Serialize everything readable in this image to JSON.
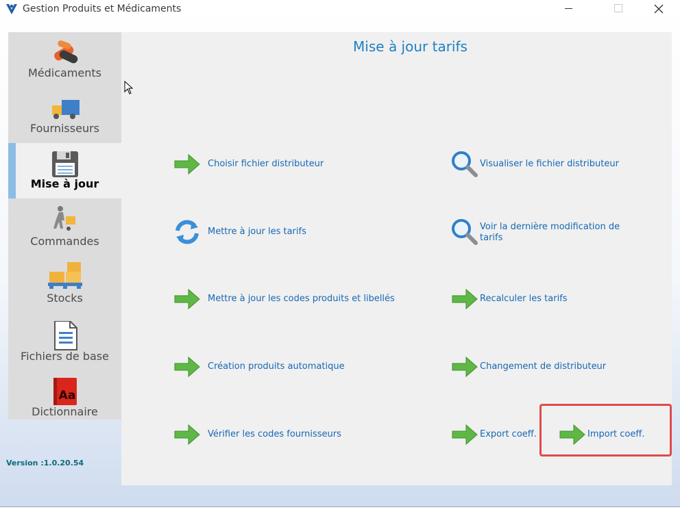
{
  "window": {
    "title": "Gestion Produits et Médicaments"
  },
  "sidebar": {
    "items": [
      {
        "label": "Médicaments",
        "icon": "medicaments-icon",
        "active": false
      },
      {
        "label": "Fournisseurs",
        "icon": "truck-icon",
        "active": false
      },
      {
        "label": "Mise à jour",
        "icon": "floppy-disk-icon",
        "active": true
      },
      {
        "label": "Commandes",
        "icon": "delivery-person-icon",
        "active": false
      },
      {
        "label": "Stocks",
        "icon": "pallet-boxes-icon",
        "active": false
      },
      {
        "label": "Fichiers de base",
        "icon": "document-icon",
        "active": false
      },
      {
        "label": "Dictionnaire",
        "icon": "dictionary-book-icon",
        "active": false
      }
    ],
    "version": "Version :1.0.20.54"
  },
  "main": {
    "title": "Mise à jour tarifs",
    "actions": [
      {
        "label": "Choisir fichier distributeur",
        "icon": "green-arrow-icon"
      },
      {
        "label": "Visualiser le fichier distributeur",
        "icon": "magnifier-icon"
      },
      {
        "label": "Mettre à jour les tarifs",
        "icon": "refresh-icon"
      },
      {
        "label": "Voir la dernière modification de tarifs",
        "icon": "magnifier-icon"
      },
      {
        "label": "Mettre à jour les codes produits et libellés",
        "icon": "green-arrow-icon"
      },
      {
        "label": "Recalculer les tarifs",
        "icon": "green-arrow-icon"
      },
      {
        "label": "Création produits automatique",
        "icon": "green-arrow-icon"
      },
      {
        "label": "Changement de distributeur",
        "icon": "green-arrow-icon"
      },
      {
        "label": "Vérifier les codes fournisseurs",
        "icon": "green-arrow-icon"
      },
      {
        "label": "Export coeff.",
        "icon": "green-arrow-icon"
      },
      {
        "label": "Import coeff.",
        "icon": "green-arrow-icon"
      }
    ]
  },
  "colors": {
    "accent": "#1d7fc4",
    "link": "#1668b5",
    "highlight": "#e04a4a",
    "active_bar": "#8cbde5",
    "version": "#0e6a78"
  }
}
